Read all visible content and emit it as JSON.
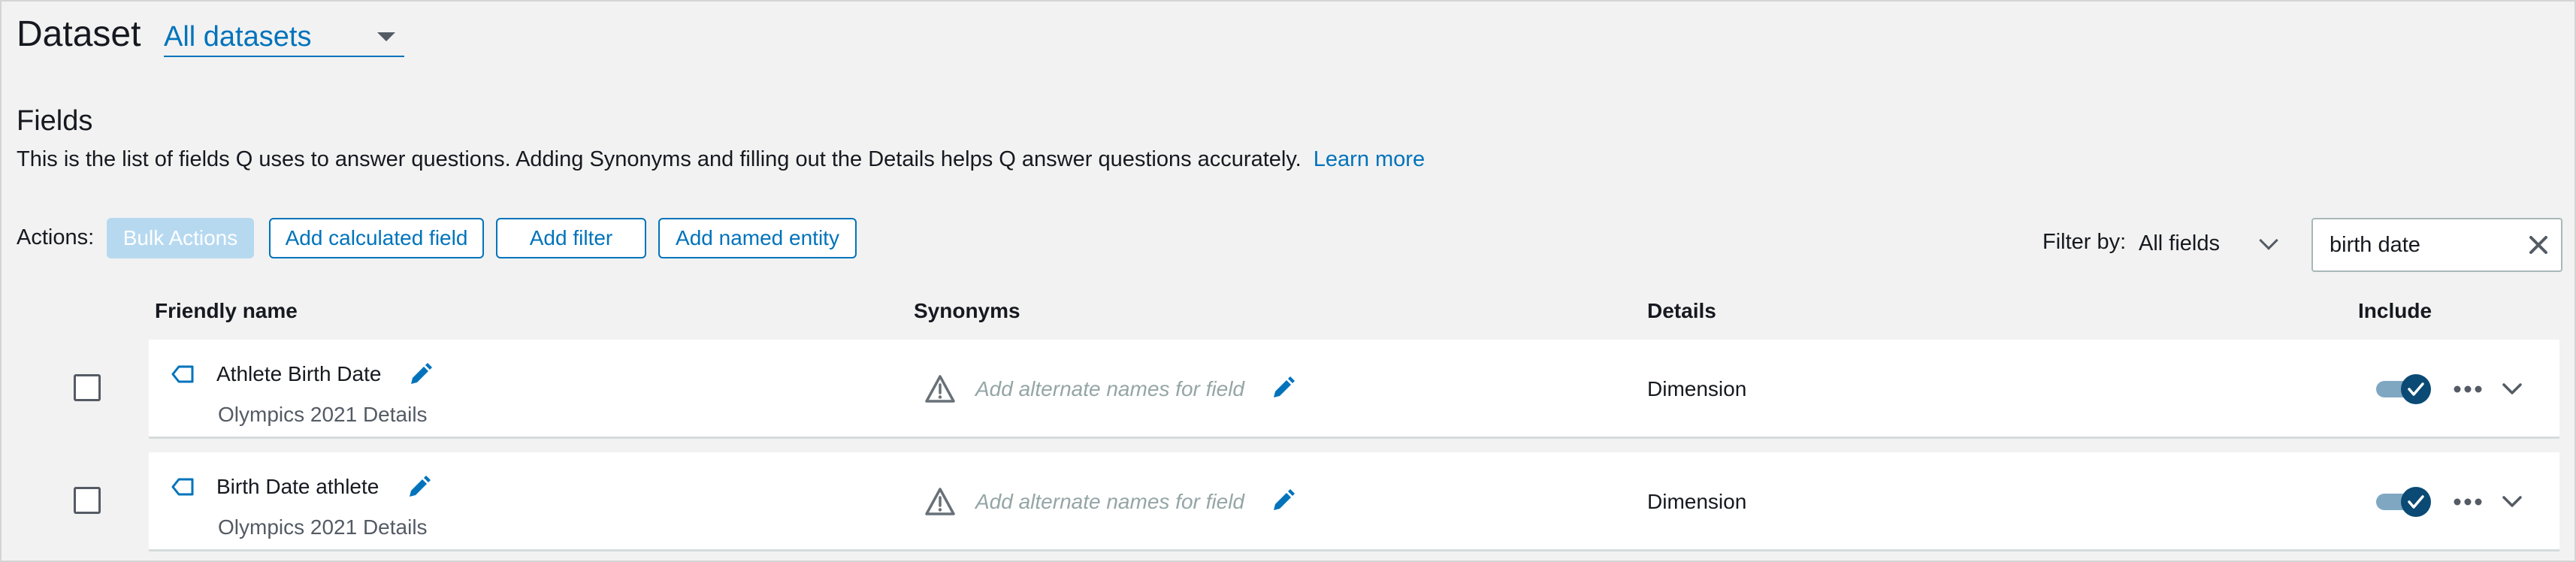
{
  "header": {
    "dataset_label": "Dataset",
    "dataset_select_value": "All datasets"
  },
  "fields_section": {
    "title": "Fields",
    "description": "This is the list of fields Q uses to answer questions. Adding Synonyms and filling out the Details helps Q answer questions accurately.",
    "learn_more": "Learn more"
  },
  "actions": {
    "label": "Actions:",
    "bulk_actions": "Bulk Actions",
    "add_calculated_field": "Add calculated field",
    "add_filter": "Add filter",
    "add_named_entity": "Add named entity"
  },
  "filter": {
    "label": "Filter by:",
    "value": "All fields"
  },
  "search": {
    "value": "birth date"
  },
  "table": {
    "columns": {
      "friendly_name": "Friendly name",
      "synonyms": "Synonyms",
      "details": "Details",
      "include": "Include"
    },
    "rows": [
      {
        "name": "Athlete Birth Date",
        "dataset": "Olympics 2021 Details",
        "synonyms_placeholder": "Add alternate names for field",
        "details": "Dimension",
        "included": true
      },
      {
        "name": "Birth Date athlete",
        "dataset": "Olympics 2021 Details",
        "synonyms_placeholder": "Add alternate names for field",
        "details": "Dimension",
        "included": true
      }
    ]
  },
  "colors": {
    "accent": "#0073bb",
    "toggle_on": "#0a4a74",
    "disabled_button": "#b6d9f0"
  },
  "icons": {
    "dataset_dropdown": "caret-down-icon",
    "filter_dropdown": "chevron-down-icon",
    "search_clear": "close-icon",
    "dimension": "tag-icon",
    "edit": "pencil-icon",
    "warning": "warning-triangle-icon",
    "more": "ellipsis-icon",
    "expand": "chevron-down-icon"
  }
}
